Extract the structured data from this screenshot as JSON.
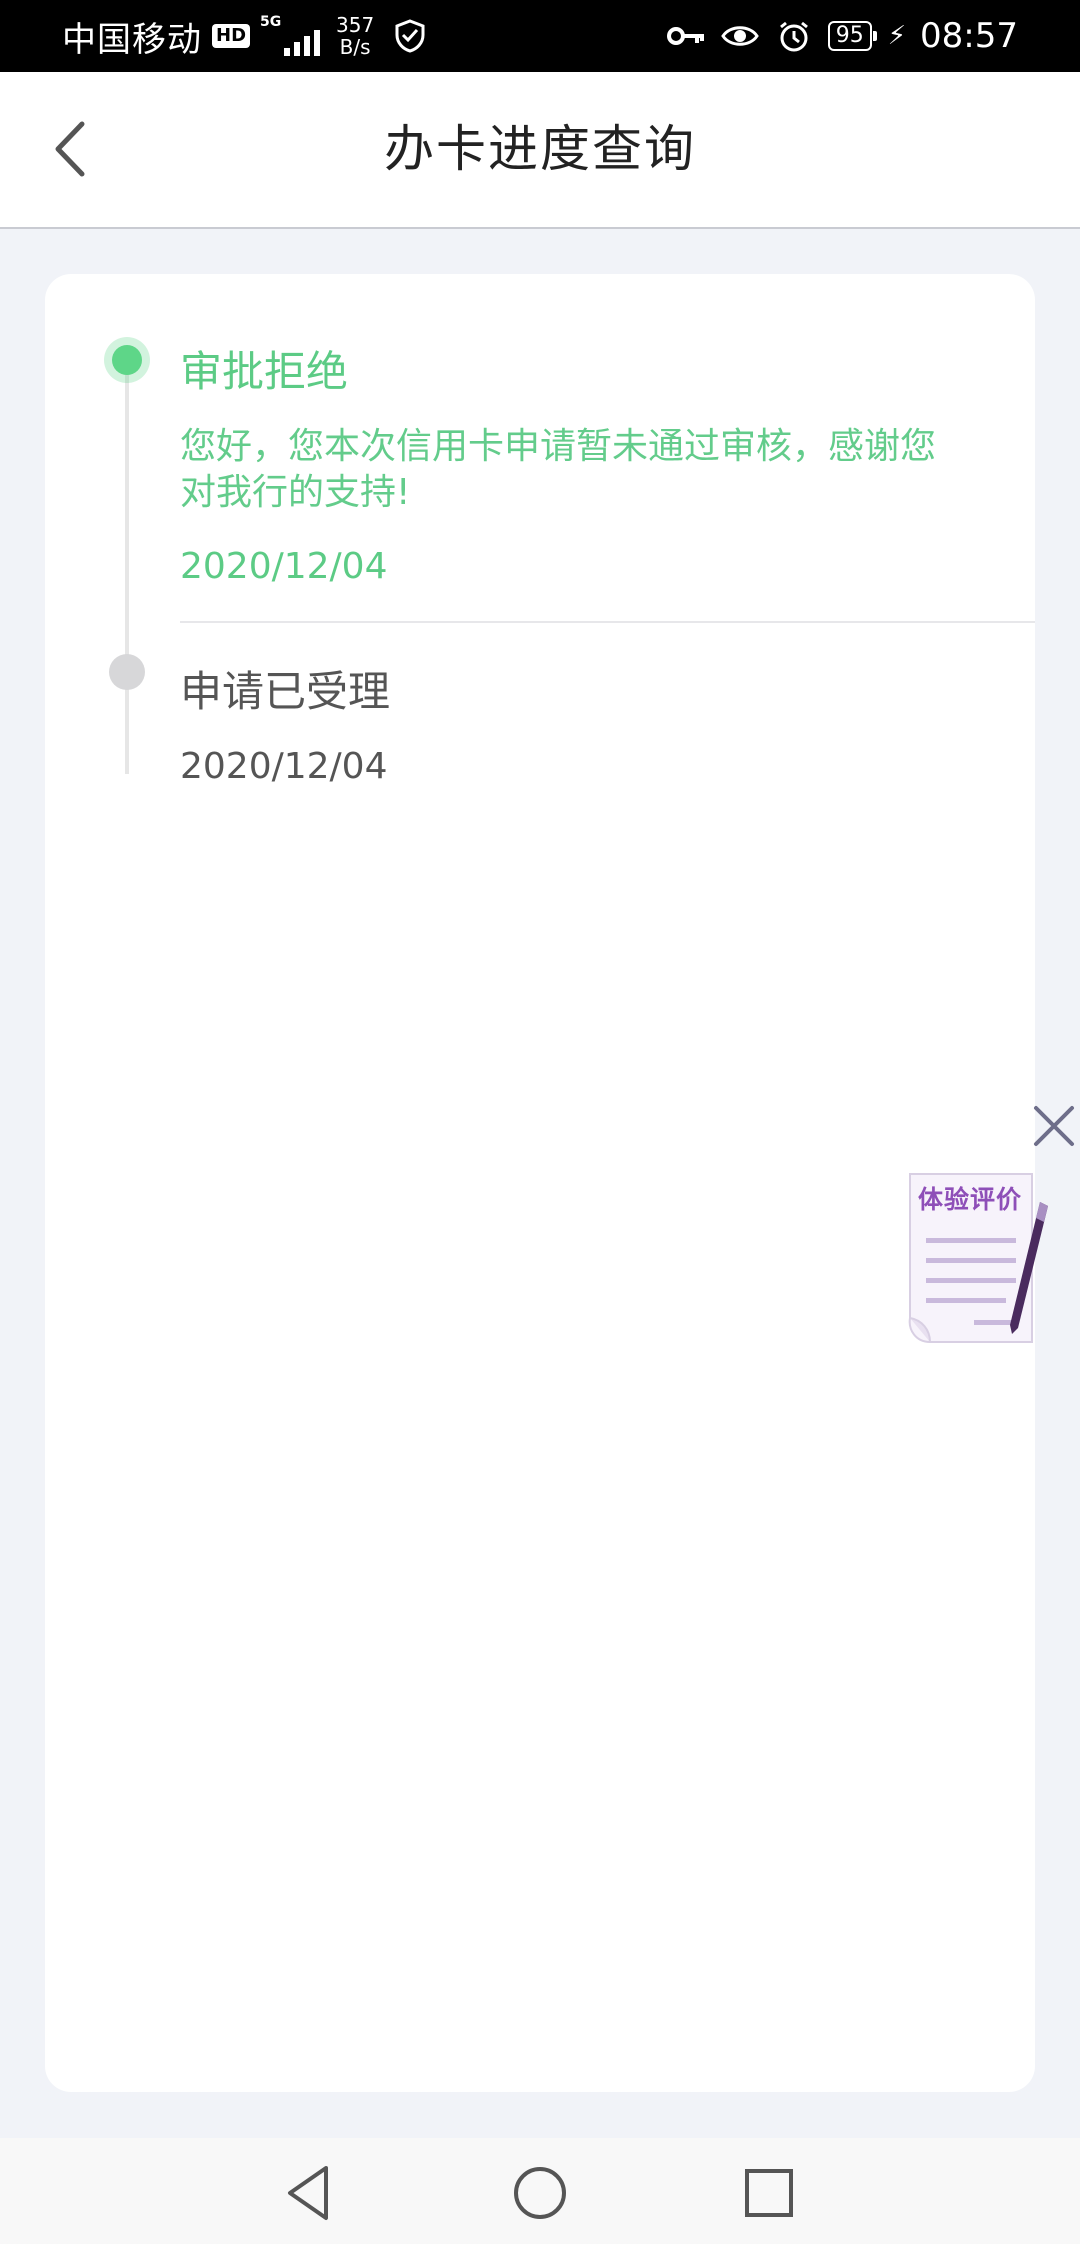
{
  "status_bar": {
    "carrier": "中国移动",
    "hd": "HD",
    "network": "5G",
    "speed_value": "357",
    "speed_unit": "B/s",
    "battery": "95",
    "time": "08:57"
  },
  "header": {
    "title": "办卡进度查询",
    "back_icon": "chevron-left-icon"
  },
  "timeline": [
    {
      "title": "审批拒绝",
      "message": "您好，您本次信用卡申请暂未通过审核，感谢您对我行的支持!",
      "date": "2020/12/04",
      "status": "active"
    },
    {
      "title": "申请已受理",
      "date": "2020/12/04",
      "status": "done"
    }
  ],
  "feedback": {
    "label": "体验评价",
    "close_icon": "close-icon"
  },
  "colors": {
    "accent_green": "#5ccb85",
    "feedback_purple": "#8e4fb8",
    "page_bg": "#f1f3f8"
  }
}
